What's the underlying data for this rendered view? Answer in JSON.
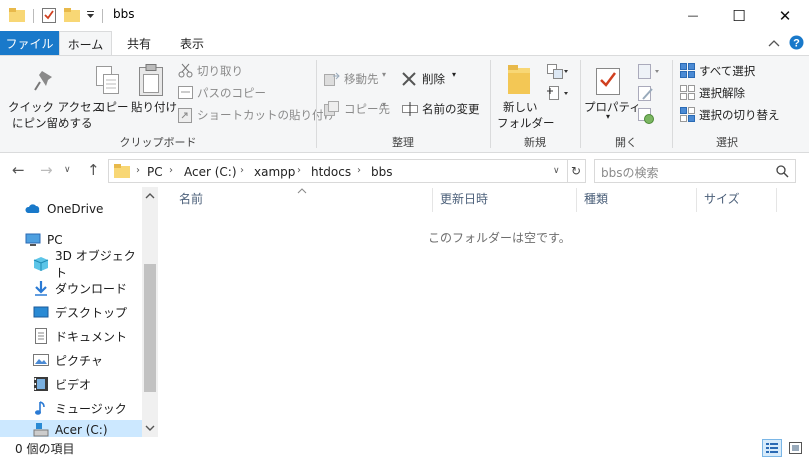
{
  "window": {
    "title": "bbs",
    "minimize": "—",
    "maximize": "☐",
    "close": "✕"
  },
  "tabs": {
    "file": "ファイル",
    "home": "ホーム",
    "share": "共有",
    "view": "表示"
  },
  "ribbon": {
    "clipboard": {
      "pin": "クイック アクセス",
      "pin2": "にピン留めする",
      "copy": "コピー",
      "paste": "貼り付け",
      "cut": "切り取り",
      "copy_path": "パスのコピー",
      "paste_shortcut": "ショートカットの貼り付け",
      "label": "クリップボード"
    },
    "organize": {
      "move_to": "移動先",
      "copy_to": "コピー先",
      "delete": "削除",
      "rename": "名前の変更",
      "label": "整理"
    },
    "new": {
      "new_folder": "新しい",
      "new_folder2": "フォルダー",
      "label": "新規"
    },
    "open": {
      "properties": "プロパティ",
      "label": "開く"
    },
    "select": {
      "select_all": "すべて選択",
      "select_none": "選択解除",
      "invert": "選択の切り替え",
      "label": "選択"
    }
  },
  "address": {
    "crumbs": [
      "PC",
      "Acer (C:)",
      "xampp",
      "htdocs",
      "bbs"
    ],
    "search_placeholder": "bbsの検索"
  },
  "navpane": {
    "items": [
      {
        "label": "OneDrive",
        "icon": "onedrive-icon"
      },
      {
        "label": "PC",
        "icon": "pc-icon"
      },
      {
        "label": "3D オブジェクト",
        "icon": "3d-objects-icon"
      },
      {
        "label": "ダウンロード",
        "icon": "download-icon"
      },
      {
        "label": "デスクトップ",
        "icon": "desktop-icon"
      },
      {
        "label": "ドキュメント",
        "icon": "document-icon"
      },
      {
        "label": "ピクチャ",
        "icon": "pictures-icon"
      },
      {
        "label": "ビデオ",
        "icon": "video-icon"
      },
      {
        "label": "ミュージック",
        "icon": "music-icon"
      },
      {
        "label": "Acer (C:)",
        "icon": "drive-icon"
      }
    ]
  },
  "columns": [
    "名前",
    "更新日時",
    "種類",
    "サイズ"
  ],
  "content": {
    "empty_message": "このフォルダーは空です。"
  },
  "status": {
    "item_count": "0 個の項目"
  },
  "colors": {
    "accent": "#1979ca",
    "folder": "#f8d775"
  }
}
